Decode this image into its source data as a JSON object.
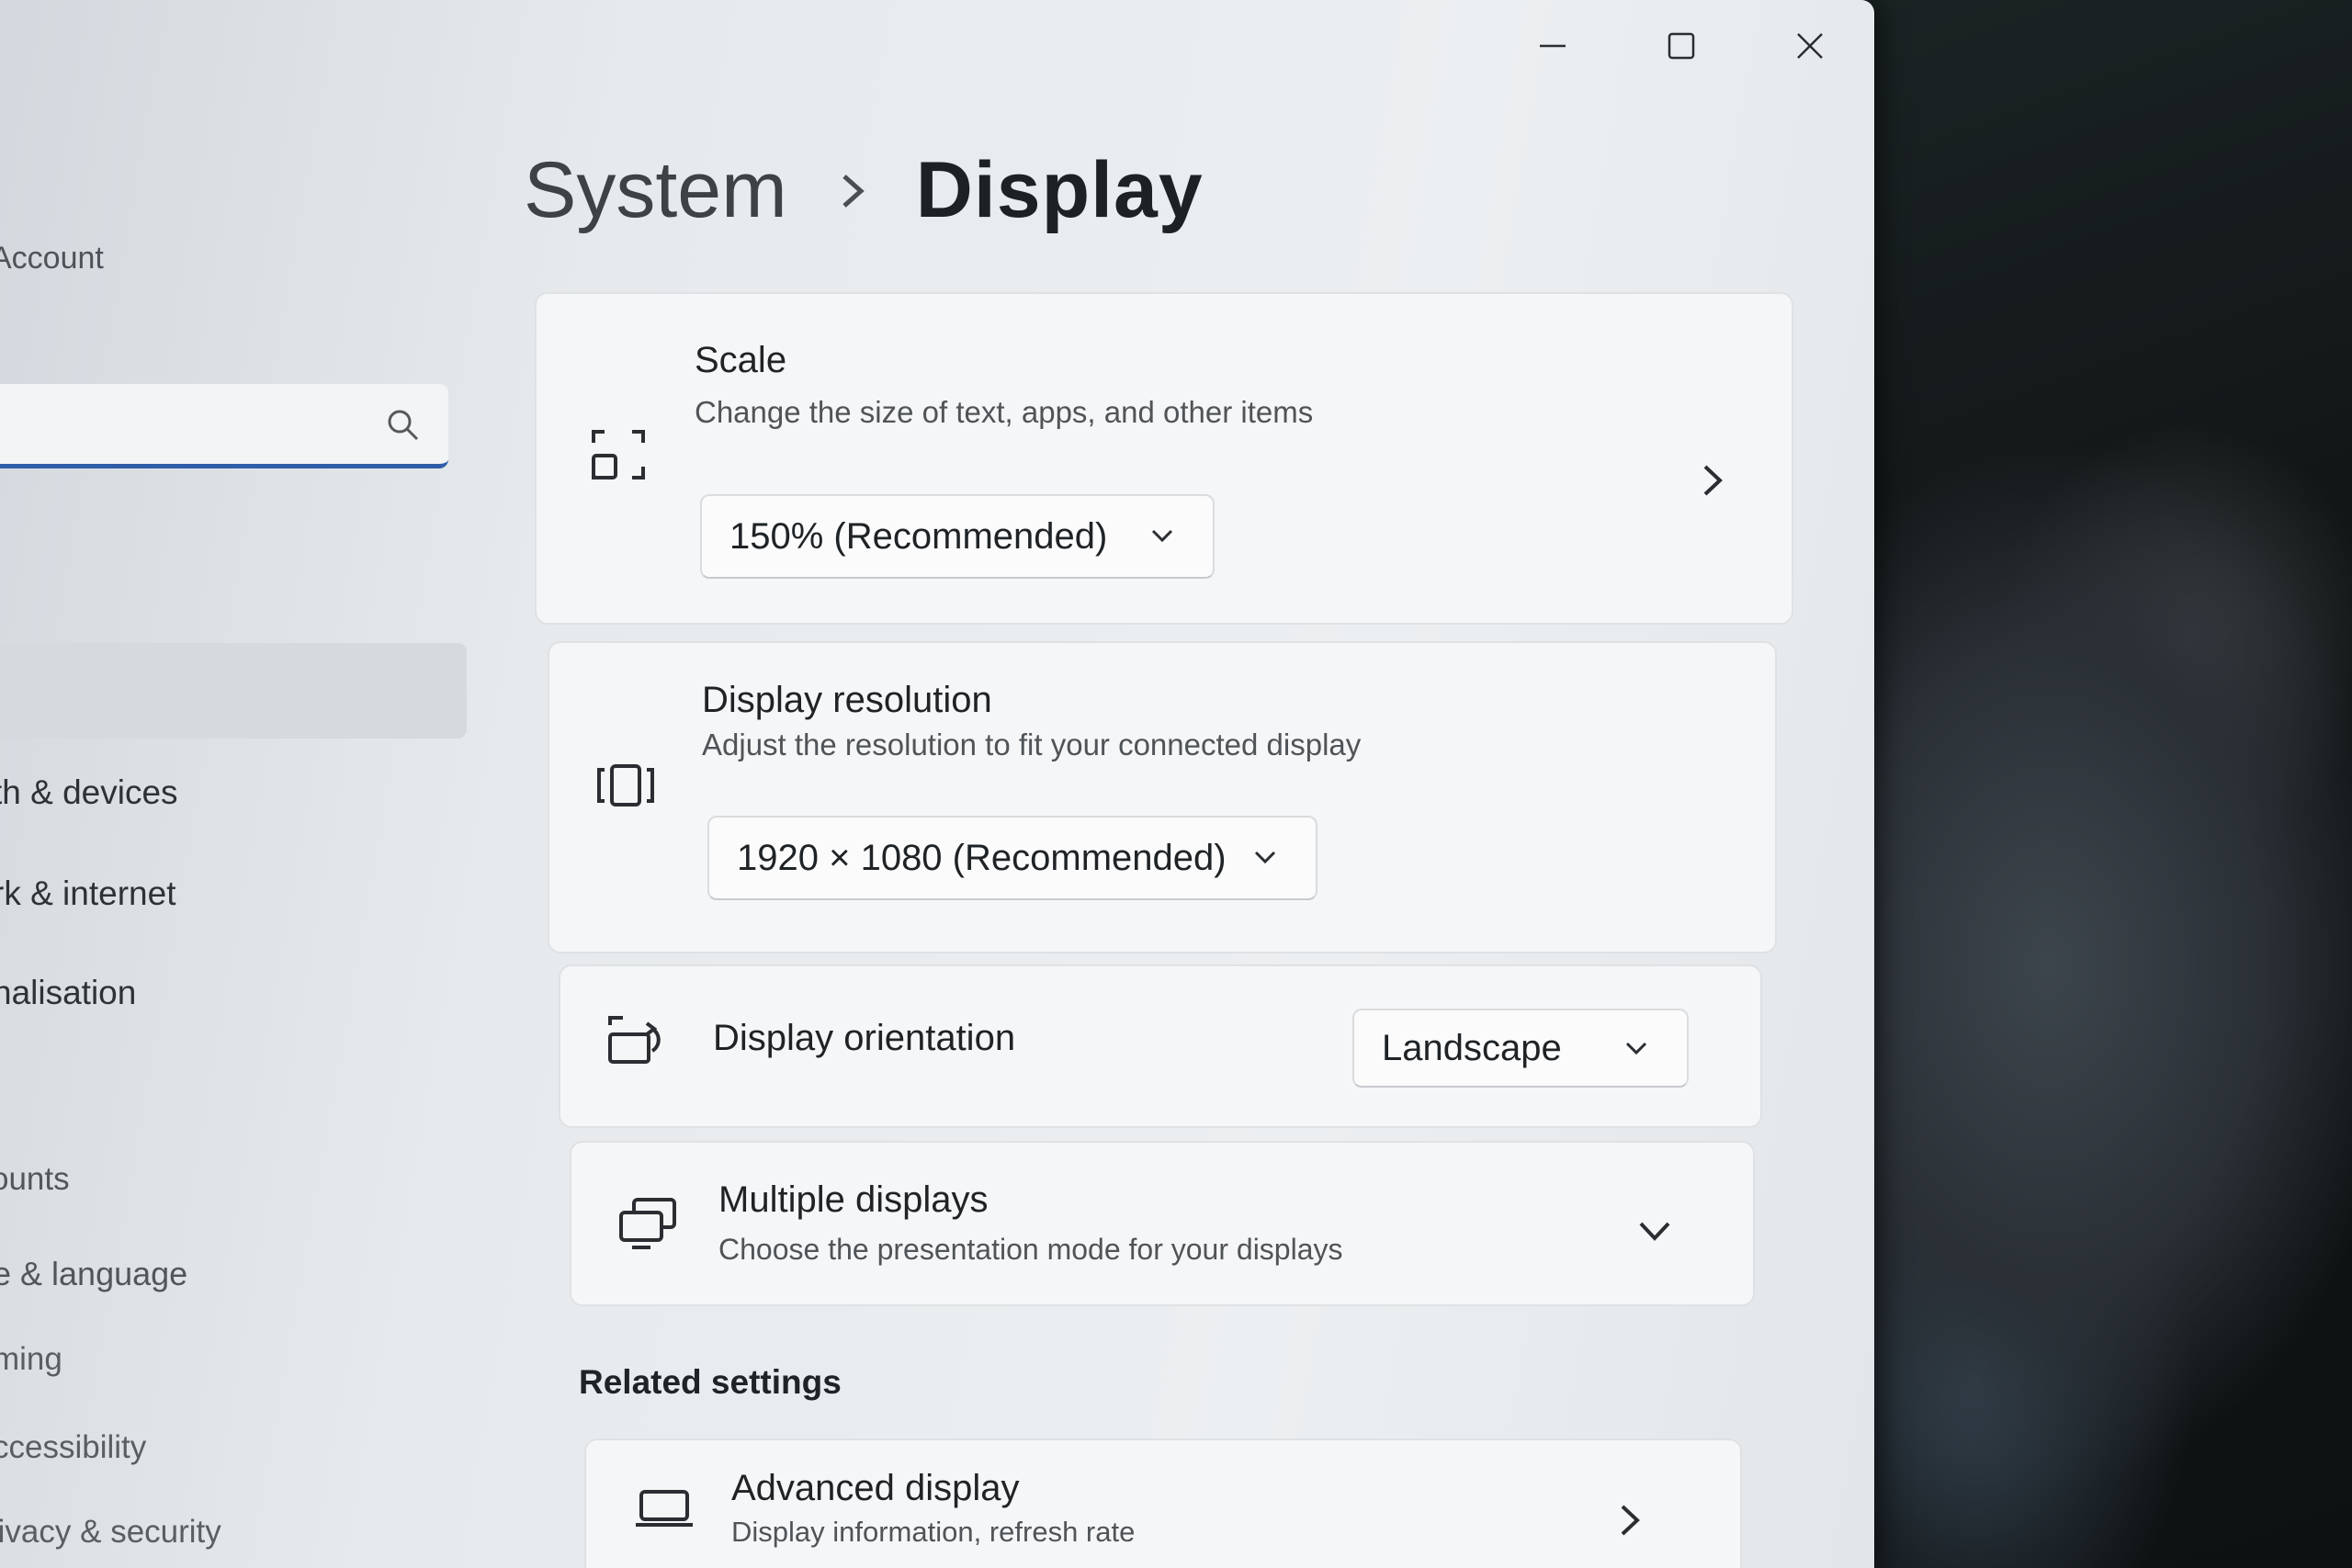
{
  "window": {
    "controls": {
      "minimize": "minimize-icon",
      "maximize": "maximize-icon",
      "close": "close-icon"
    }
  },
  "sidebar": {
    "account_label": "Account",
    "search": {
      "placeholder": "",
      "icon": "search-icon"
    },
    "items": [
      {
        "label": "th & devices"
      },
      {
        "label": "rk & internet"
      },
      {
        "label": "nalisation"
      },
      {
        "label": "ounts"
      },
      {
        "label": "e & language"
      },
      {
        "label": "ming"
      },
      {
        "label": "ccessibility"
      },
      {
        "label": "rivacy & security"
      }
    ]
  },
  "breadcrumb": {
    "parent": "System",
    "separator_icon": "chevron-right-icon",
    "current": "Display"
  },
  "cards": {
    "scale": {
      "icon": "scale-icon",
      "title": "Scale",
      "subtitle": "Change the size of text, apps, and other items",
      "value": "150% (Recommended)"
    },
    "resolution": {
      "icon": "resolution-icon",
      "title": "Display resolution",
      "subtitle": "Adjust the resolution to fit your connected display",
      "value": "1920 × 1080 (Recommended)"
    },
    "orientation": {
      "icon": "orientation-icon",
      "title": "Display orientation",
      "value": "Landscape"
    },
    "multiple": {
      "icon": "multiple-displays-icon",
      "title": "Multiple displays",
      "subtitle": "Choose the presentation mode for your displays"
    }
  },
  "related": {
    "heading": "Related settings",
    "advanced": {
      "icon": "monitor-icon",
      "title": "Advanced display",
      "subtitle": "Display information, refresh rate"
    }
  },
  "colors": {
    "accent": "#2f5da8",
    "window_bg": "#eceff1",
    "card_bg": "#f5f6f7",
    "text_primary": "#1f2326"
  }
}
